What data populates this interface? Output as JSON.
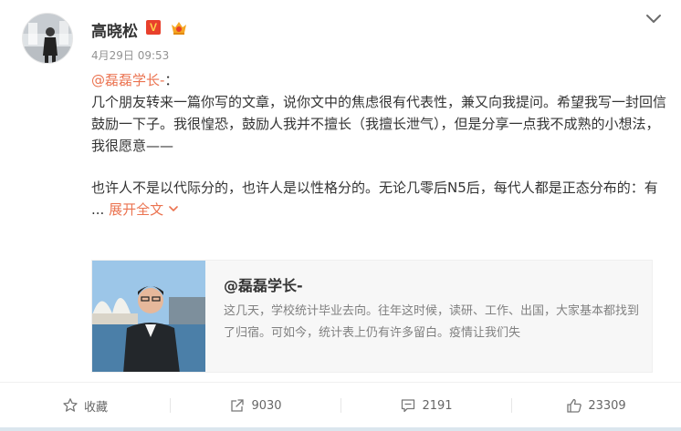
{
  "author": {
    "name": "高晓松",
    "vip_letter": "V",
    "timestamp": "4月29日 09:53"
  },
  "post": {
    "mention": "@磊磊学长-",
    "mention_suffix": "：",
    "paragraph1": "几个朋友转来一篇你写的文章，说你文中的焦虑很有代表性，兼又向我提问。希望我写一封回信鼓励一下子。我很惶恐，鼓励人我并不擅长（我擅长泄气），但是分享一点我不成熟的小想法，我很愿意——",
    "paragraph2": "也许人不是以代际分的，也许人是以性格分的。无论几零后N5后，每代人都是正态分布的：有 ...",
    "expand_label": "展开全文"
  },
  "link_card": {
    "title": "@磊磊学长-",
    "description": "这几天，学校统计毕业去向。往年这时候，读研、工作、出国，大家基本都找到了归宿。可如今，统计表上仍有许多留白。疫情让我们失"
  },
  "actions": {
    "favorite": "收藏",
    "repost": "9030",
    "comment": "2191",
    "like": "23309"
  },
  "colors": {
    "accent": "#eb7350",
    "vip": "#e8402c"
  }
}
